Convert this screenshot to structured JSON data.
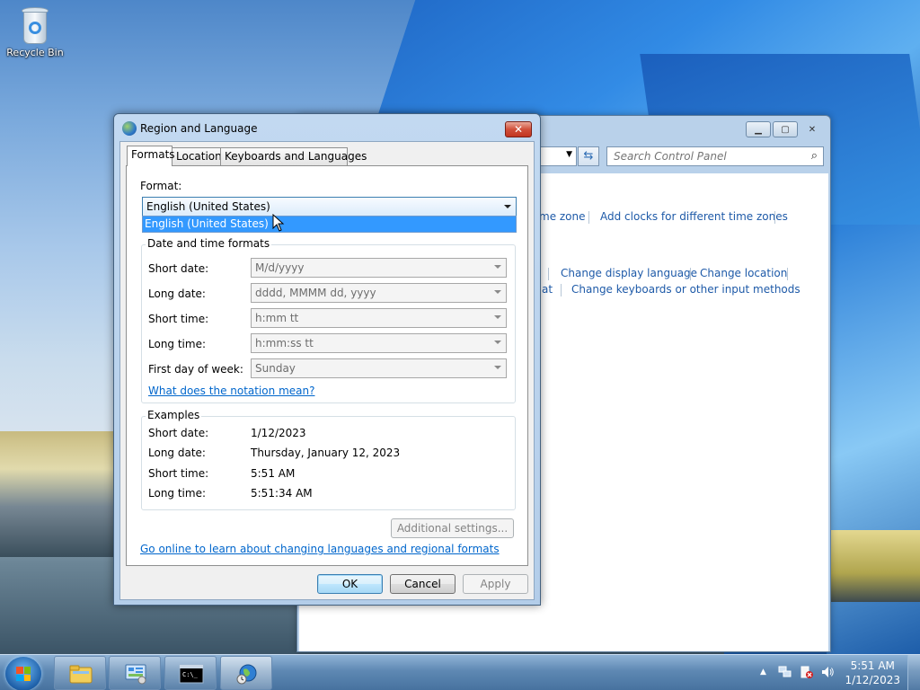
{
  "desktop": {
    "recycle_bin_label": "Recycle Bin"
  },
  "control_panel": {
    "search_placeholder": "Search Control Panel",
    "links": [
      "me zone",
      "Add clocks for different time zones",
      "Change display language",
      "Change location",
      "at",
      "Change keyboards or other input methods"
    ]
  },
  "dialog": {
    "title": "Region and Language",
    "close_label": "✕",
    "tabs": [
      "Formats",
      "Location",
      "Keyboards and Languages"
    ],
    "format_label": "Format:",
    "format_value": "English (United States)",
    "format_dropdown_option": "English (United States)",
    "date_time_group_title": "Date and time formats",
    "fields": [
      {
        "label": "Short date:",
        "value": "M/d/yyyy"
      },
      {
        "label": "Long date:",
        "value": "dddd, MMMM dd, yyyy"
      },
      {
        "label": "Short time:",
        "value": "h:mm tt"
      },
      {
        "label": "Long time:",
        "value": "h:mm:ss tt"
      },
      {
        "label": "First day of week:",
        "value": "Sunday"
      }
    ],
    "notation_link": "What does the notation mean?",
    "examples_group_title": "Examples",
    "examples": [
      {
        "label": "Short date:",
        "value": "1/12/2023"
      },
      {
        "label": "Long date:",
        "value": "Thursday, January 12, 2023"
      },
      {
        "label": "Short time:",
        "value": "5:51 AM"
      },
      {
        "label": "Long time:",
        "value": "5:51:34 AM"
      }
    ],
    "additional_settings_label": "Additional settings...",
    "online_link": "Go online to learn about changing languages and regional formats",
    "ok_label": "OK",
    "cancel_label": "Cancel",
    "apply_label": "Apply"
  },
  "taskbar": {
    "clock_time": "5:51 AM",
    "clock_date": "1/12/2023",
    "tray_arrow": "▲"
  }
}
